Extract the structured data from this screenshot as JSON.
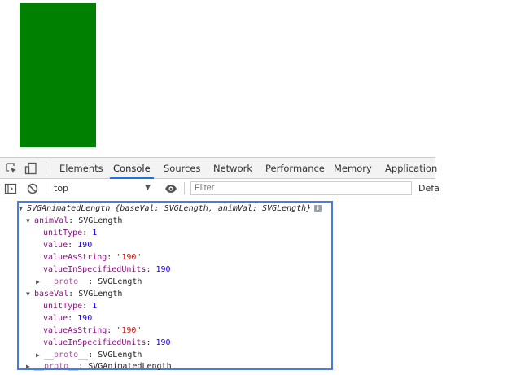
{
  "page": {
    "rect_color": "#008000"
  },
  "devtools": {
    "tabs": [
      {
        "label": "Elements"
      },
      {
        "label": "Console"
      },
      {
        "label": "Sources"
      },
      {
        "label": "Network"
      },
      {
        "label": "Performance"
      },
      {
        "label": "Memory"
      },
      {
        "label": "Application"
      }
    ],
    "active_tab": "Console",
    "accent": "#1a73e8",
    "context": "top",
    "filter_placeholder": "Filter",
    "levels_label": "Defa",
    "highlight_color": "#4a7be0"
  },
  "console": {
    "header_type": "SVGAnimatedLength",
    "header_summary": "{baseVal: SVGLength, animVal: SVGLength}",
    "anim": {
      "key": "animVal",
      "type": "SVGLength",
      "props": [
        {
          "key": "unitType",
          "value": "1",
          "kind": "num"
        },
        {
          "key": "value",
          "value": "190",
          "kind": "num"
        },
        {
          "key": "valueAsString",
          "value": "\"190\"",
          "kind": "str"
        },
        {
          "key": "valueInSpecifiedUnits",
          "value": "190",
          "kind": "num"
        }
      ],
      "proto_key": "__proto__",
      "proto_type": "SVGLength"
    },
    "base": {
      "key": "baseVal",
      "type": "SVGLength",
      "props": [
        {
          "key": "unitType",
          "value": "1",
          "kind": "num"
        },
        {
          "key": "value",
          "value": "190",
          "kind": "num"
        },
        {
          "key": "valueAsString",
          "value": "\"190\"",
          "kind": "str"
        },
        {
          "key": "valueInSpecifiedUnits",
          "value": "190",
          "kind": "num"
        }
      ],
      "proto_key": "__proto__",
      "proto_type": "SVGLength"
    },
    "root_proto_key": "__proto__",
    "root_proto_type": "SVGAnimatedLength"
  }
}
